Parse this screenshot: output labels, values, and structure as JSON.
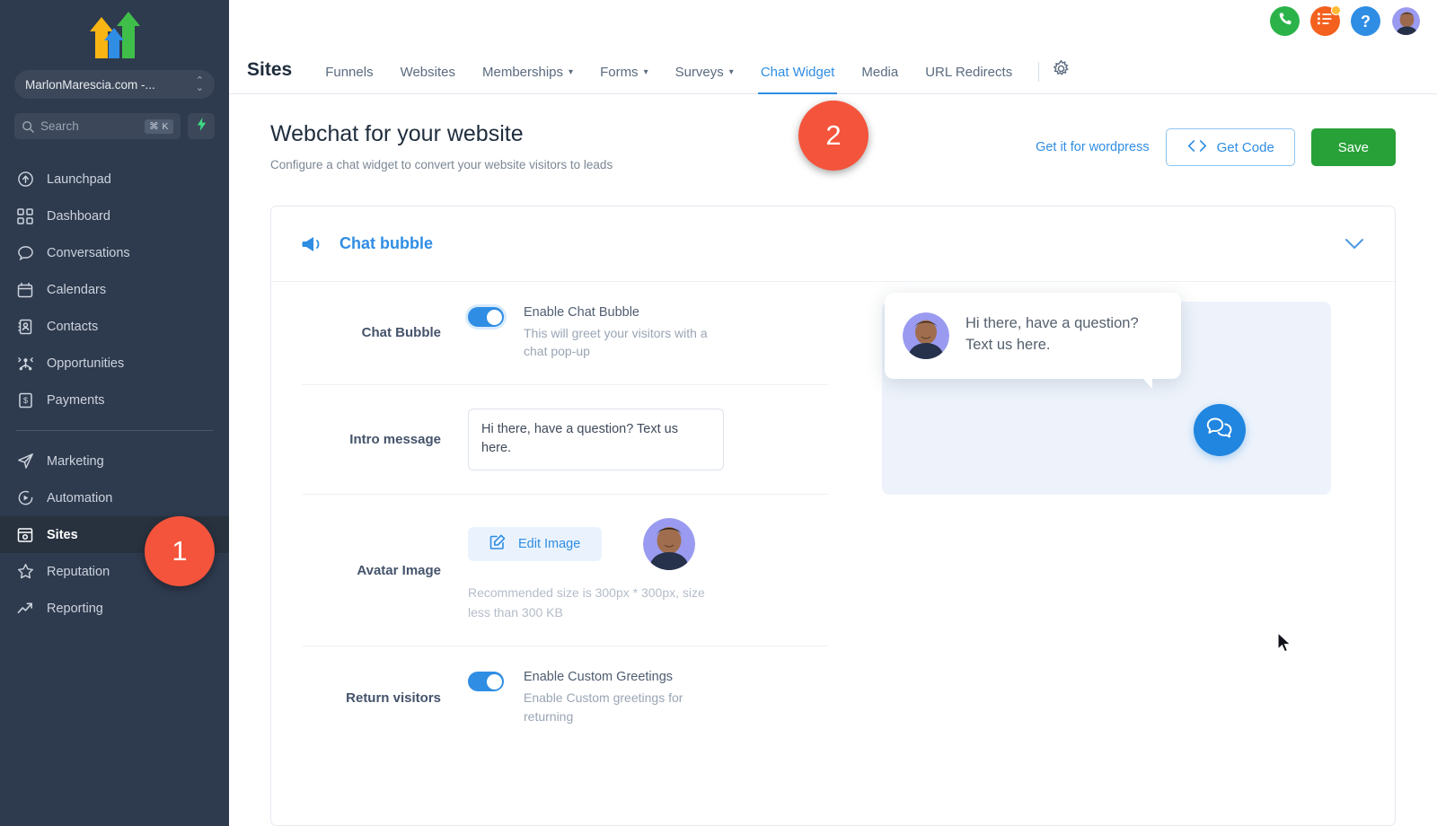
{
  "sidebar": {
    "logo_name": "three-arrows-logo",
    "workspace": {
      "name": "MarlonMarescia.com -...",
      "icon": "updown-chevrons-icon"
    },
    "search": {
      "placeholder": "Search",
      "shortcut": "⌘ K",
      "icon": "search-icon"
    },
    "bolt": {
      "icon": "lightning-bolt-icon"
    },
    "items": [
      {
        "label": "Launchpad",
        "icon": "rocket-launchpad-icon",
        "active": false
      },
      {
        "label": "Dashboard",
        "icon": "grid-dashboard-icon",
        "active": false
      },
      {
        "label": "Conversations",
        "icon": "chat-bubble-icon",
        "active": false
      },
      {
        "label": "Calendars",
        "icon": "calendar-icon",
        "active": false
      },
      {
        "label": "Contacts",
        "icon": "contacts-book-icon",
        "active": false
      },
      {
        "label": "Opportunities",
        "icon": "opportunities-network-icon",
        "active": false
      },
      {
        "label": "Payments",
        "icon": "payments-receipt-icon",
        "active": false
      }
    ],
    "items2": [
      {
        "label": "Marketing",
        "icon": "paper-plane-icon",
        "active": false
      },
      {
        "label": "Automation",
        "icon": "play-circle-icon",
        "active": false
      },
      {
        "label": "Sites",
        "icon": "sites-window-icon",
        "active": true
      },
      {
        "label": "Reputation",
        "icon": "star-icon",
        "active": false
      },
      {
        "label": "Reporting",
        "icon": "trend-up-arrow-icon",
        "active": false
      }
    ]
  },
  "topbar": {
    "buttons": [
      {
        "name": "phone-call-button",
        "icon": "phone-icon",
        "color": "#2bb34a"
      },
      {
        "name": "tasks-button",
        "icon": "list-checklist-icon",
        "color": "#f4601e",
        "has_badge": true
      },
      {
        "name": "help-button",
        "icon": "question-mark-icon",
        "color": "#2f8de4"
      }
    ],
    "avatar": "user-avatar"
  },
  "navbar": {
    "brand": "Sites",
    "tabs": [
      {
        "label": "Funnels",
        "has_caret": false,
        "active": false
      },
      {
        "label": "Websites",
        "has_caret": false,
        "active": false
      },
      {
        "label": "Memberships",
        "has_caret": true,
        "active": false
      },
      {
        "label": "Forms",
        "has_caret": true,
        "active": false
      },
      {
        "label": "Surveys",
        "has_caret": true,
        "active": false
      },
      {
        "label": "Chat Widget",
        "has_caret": false,
        "active": true
      },
      {
        "label": "Media",
        "has_caret": false,
        "active": false
      },
      {
        "label": "URL Redirects",
        "has_caret": false,
        "active": false
      }
    ],
    "settings_icon": "gear-icon"
  },
  "page": {
    "title": "Webchat for your website",
    "subtitle": "Configure a chat widget to convert your website visitors to leads",
    "wordpress_link": "Get it for wordpress",
    "get_code_label": "Get Code",
    "get_code_icon": "code-brackets-icon",
    "save_label": "Save"
  },
  "card": {
    "icon": "megaphone-icon",
    "title": "Chat bubble",
    "collapse_icon": "chevron-down-icon",
    "rows": [
      {
        "label": "Chat Bubble",
        "type": "toggle",
        "toggle_on": true,
        "title": "Enable Chat Bubble",
        "desc": "This will greet your visitors with a chat pop-up"
      },
      {
        "label": "Intro message",
        "type": "textarea",
        "value": "Hi there, have a question? Text us here."
      },
      {
        "label": "Avatar Image",
        "type": "image",
        "button_label": "Edit Image",
        "button_icon": "edit-pencil-square-icon",
        "hint": "Recommended size is 300px * 300px, size less than 300 KB",
        "avatar": "avatar-thumbnail"
      },
      {
        "label": "Return visitors",
        "type": "toggle",
        "toggle_on": true,
        "title": "Enable Custom Greetings",
        "desc": "Enable Custom greetings for returning"
      }
    ]
  },
  "preview": {
    "bubble_text": "Hi there, have a question? Text us here.",
    "bubble_avatar": "preview-avatar",
    "launcher_icon": "chat-bubbles-icon"
  },
  "steps": [
    {
      "number": "1"
    },
    {
      "number": "2"
    }
  ],
  "colors": {
    "sidebar_bg": "#2e3a4e",
    "accent_blue": "#2f8de4",
    "save_green": "#28a138",
    "step_red": "#f4543c"
  }
}
